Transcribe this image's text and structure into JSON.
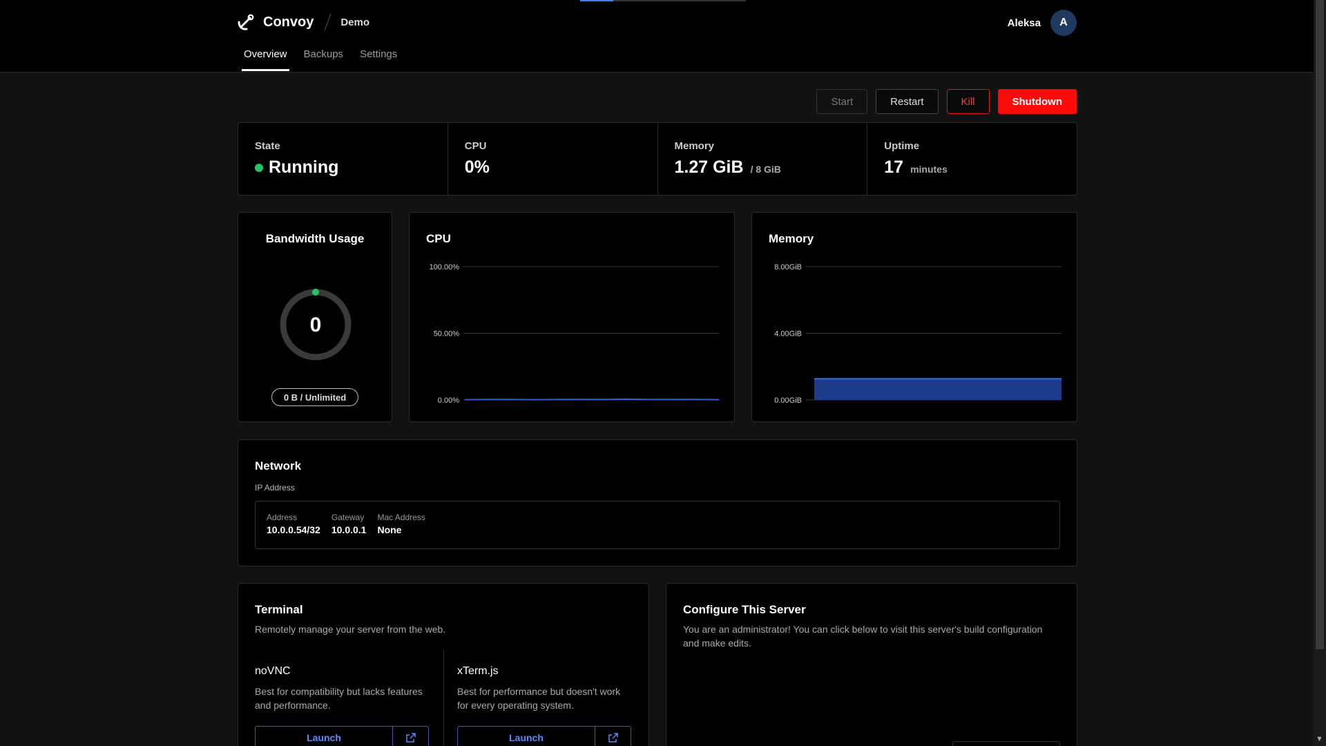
{
  "header": {
    "app_name": "Convoy",
    "server_name": "Demo",
    "user_name": "Aleksa",
    "avatar_initial": "A",
    "logo_icon": "anchor-icon"
  },
  "tabs": [
    {
      "label": "Overview",
      "active": true
    },
    {
      "label": "Backups",
      "active": false
    },
    {
      "label": "Settings",
      "active": false
    }
  ],
  "actions": {
    "start": "Start",
    "restart": "Restart",
    "kill": "Kill",
    "shutdown": "Shutdown"
  },
  "stats": {
    "state": {
      "label": "State",
      "value": "Running",
      "color": "#22c55e"
    },
    "cpu": {
      "label": "CPU",
      "value": "0%"
    },
    "memory": {
      "label": "Memory",
      "value": "1.27 GiB",
      "sub": "/ 8 GiB"
    },
    "uptime": {
      "label": "Uptime",
      "value": "17",
      "sub": "minutes"
    }
  },
  "bandwidth": {
    "title": "Bandwidth Usage",
    "value": "0",
    "pill": "0 B / Unlimited",
    "fraction": 0
  },
  "chart_data": [
    {
      "type": "line",
      "title": "CPU",
      "ticks": [
        "100.00%",
        "50.00%",
        "0.00%"
      ],
      "ylim": [
        0,
        100
      ],
      "values": [
        0.2,
        0.3,
        0.3,
        0.2,
        0.3,
        0.4,
        0.3,
        0.6,
        0.3,
        0.3,
        0.4,
        0.2
      ]
    },
    {
      "type": "area",
      "title": "Memory",
      "ticks": [
        "8.00GiB",
        "4.00GiB",
        "0.00GiB"
      ],
      "ylim": [
        0,
        8
      ],
      "values": [
        1.27,
        1.27,
        1.27,
        1.27,
        1.27,
        1.27,
        1.27,
        1.27
      ],
      "color": "#1e3a8a"
    }
  ],
  "network": {
    "title": "Network",
    "subtitle": "IP Address",
    "address_label": "Address",
    "address": "10.0.0.54/32",
    "gateway_label": "Gateway",
    "gateway": "10.0.0.1",
    "mac_label": "Mac Address",
    "mac": "None"
  },
  "terminal": {
    "title": "Terminal",
    "description": "Remotely manage your server from the web.",
    "novnc_title": "noVNC",
    "novnc_desc": "Best for compatibility but lacks features and performance.",
    "xterm_title": "xTerm.js",
    "xterm_desc": "Best for performance but doesn't work for every operating system.",
    "launch": "Launch"
  },
  "configure": {
    "title": "Configure This Server",
    "description": "You are an administrator! You can click below to visit this server's build configuration and make edits."
  }
}
